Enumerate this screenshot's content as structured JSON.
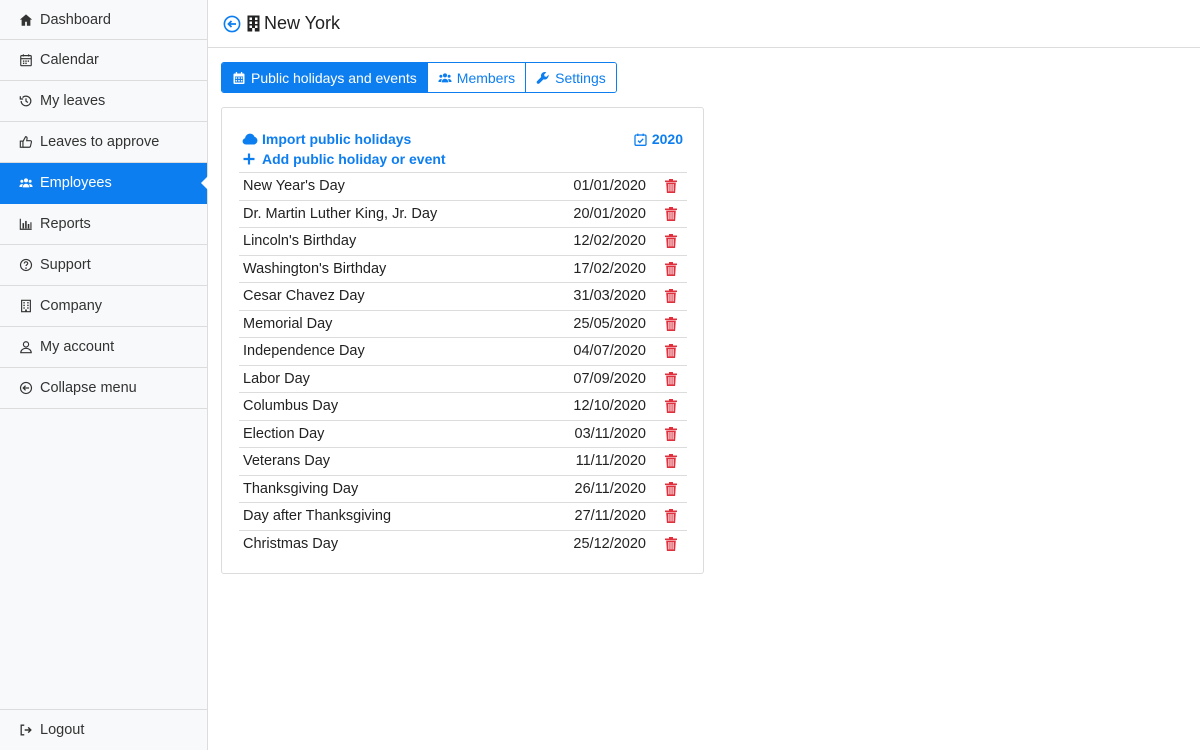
{
  "sidebar": {
    "items": [
      {
        "label": "Dashboard",
        "icon": "home-icon"
      },
      {
        "label": "Calendar",
        "icon": "calendar-icon"
      },
      {
        "label": "My leaves",
        "icon": "history-icon"
      },
      {
        "label": "Leaves to approve",
        "icon": "thumbs-up-icon"
      },
      {
        "label": "Employees",
        "icon": "users-icon"
      },
      {
        "label": "Reports",
        "icon": "bar-chart-icon"
      },
      {
        "label": "Support",
        "icon": "question-circle-icon"
      },
      {
        "label": "Company",
        "icon": "building-icon"
      },
      {
        "label": "My account",
        "icon": "user-icon"
      },
      {
        "label": "Collapse menu",
        "icon": "arrow-circle-left-icon"
      }
    ],
    "active_index": 4,
    "logout_label": "Logout"
  },
  "header": {
    "title": "New York"
  },
  "tabs": [
    {
      "label": "Public holidays and events",
      "icon": "calendar-icon"
    },
    {
      "label": "Members",
      "icon": "users-icon"
    },
    {
      "label": "Settings",
      "icon": "wrench-icon"
    }
  ],
  "card": {
    "import_label": "Import public holidays",
    "add_label": "Add public holiday or event",
    "year": "2020",
    "holidays": [
      {
        "name": "New Year's Day",
        "date": "01/01/2020"
      },
      {
        "name": "Dr. Martin Luther King, Jr. Day",
        "date": "20/01/2020"
      },
      {
        "name": "Lincoln's Birthday",
        "date": "12/02/2020"
      },
      {
        "name": "Washington's Birthday",
        "date": "17/02/2020"
      },
      {
        "name": "Cesar Chavez Day",
        "date": "31/03/2020"
      },
      {
        "name": "Memorial Day",
        "date": "25/05/2020"
      },
      {
        "name": "Independence Day",
        "date": "04/07/2020"
      },
      {
        "name": "Labor Day",
        "date": "07/09/2020"
      },
      {
        "name": "Columbus Day",
        "date": "12/10/2020"
      },
      {
        "name": "Election Day",
        "date": "03/11/2020"
      },
      {
        "name": "Veterans Day",
        "date": "11/11/2020"
      },
      {
        "name": "Thanksgiving Day",
        "date": "26/11/2020"
      },
      {
        "name": "Day after Thanksgiving",
        "date": "27/11/2020"
      },
      {
        "name": "Christmas Day",
        "date": "25/12/2020"
      }
    ]
  },
  "colors": {
    "accent": "#0d7ef0",
    "danger": "#e0303e"
  }
}
